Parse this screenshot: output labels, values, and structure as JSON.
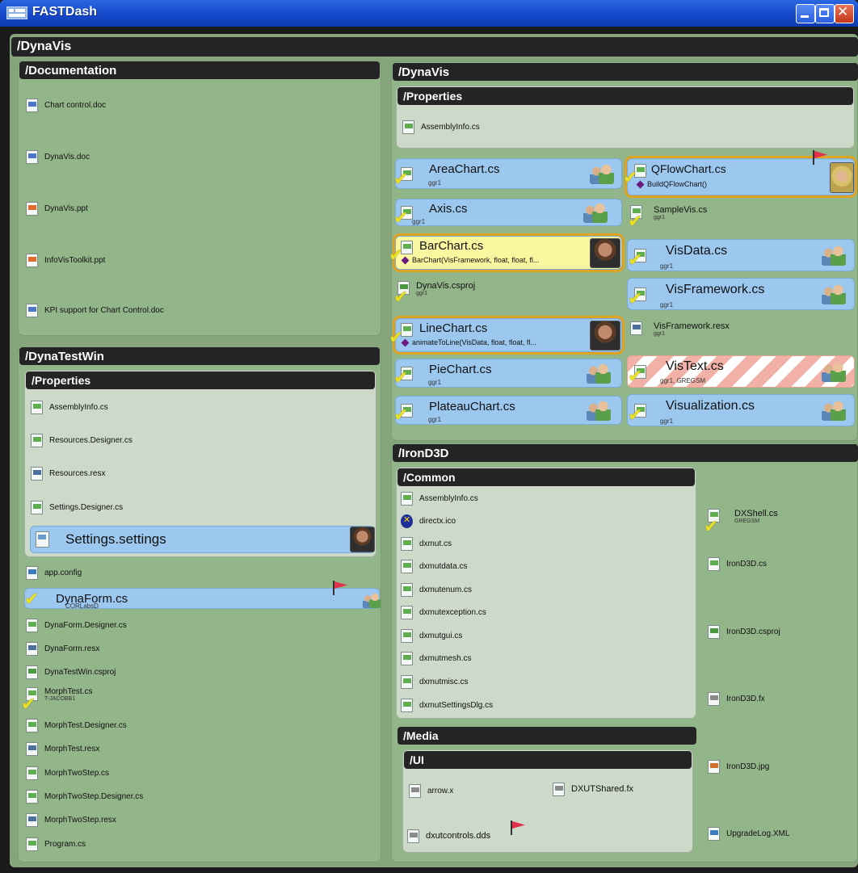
{
  "window": {
    "title": "FASTDash",
    "controls": [
      "minimize-icon",
      "maximize-icon",
      "close-icon"
    ],
    "root_header": "/DynaVis"
  },
  "documentation": {
    "header": "/Documentation",
    "files": [
      {
        "name": "Chart control.doc",
        "icon": "word-doc-icon"
      },
      {
        "name": "DynaVis.doc",
        "icon": "word-doc-icon"
      },
      {
        "name": "DynaVis.ppt",
        "icon": "powerpoint-icon"
      },
      {
        "name": "InfoVisToolkit.ppt",
        "icon": "powerpoint-icon"
      },
      {
        "name": "KPI support for Chart Control.doc",
        "icon": "word-doc-icon"
      }
    ]
  },
  "dynatestwin": {
    "header": "/DynaTestWin",
    "properties": {
      "header": "/Properties",
      "files": [
        "AssemblyInfo.cs",
        "Resources.Designer.cs",
        "Resources.resx",
        "Settings.Designer.cs"
      ],
      "active_file": "Settings.settings"
    },
    "files": [
      {
        "name": "app.config"
      },
      {
        "name": "DynaForm.cs",
        "user": "CORLabsD"
      },
      {
        "name": "DynaForm.Designer.cs"
      },
      {
        "name": "DynaForm.resx"
      },
      {
        "name": "DynaTestWin.csproj"
      },
      {
        "name": "MorphTest.cs",
        "user": "T-JACOBB1"
      },
      {
        "name": "MorphTest.Designer.cs"
      },
      {
        "name": "MorphTest.resx"
      },
      {
        "name": "MorphTwoStep.cs"
      },
      {
        "name": "MorphTwoStep.Designer.cs"
      },
      {
        "name": "MorphTwoStep.resx"
      },
      {
        "name": "Program.cs"
      }
    ]
  },
  "dynavis": {
    "header": "/DynaVis",
    "properties": {
      "header": "/Properties",
      "files": [
        "AssemblyInfo.cs"
      ]
    },
    "left_files": [
      {
        "name": "AreaChart.cs",
        "user": "ggr1"
      },
      {
        "name": "Axis.cs",
        "user": "ggr1"
      },
      {
        "name": "BarChart.cs",
        "method": "BarChart(VisFramework, float, float, fl..."
      },
      {
        "name": "DynaVis.csproj",
        "user": "ggr1"
      },
      {
        "name": "LineChart.cs",
        "method": "animateToLine(VisData, float, float, fl..."
      },
      {
        "name": "PieChart.cs",
        "user": "ggr1"
      },
      {
        "name": "PlateauChart.cs",
        "user": "ggr1"
      }
    ],
    "right_files": [
      {
        "name": "QFlowChart.cs",
        "method": "BuildQFlowChart()"
      },
      {
        "name": "SampleVis.cs",
        "user": "ggr1"
      },
      {
        "name": "VisData.cs",
        "user": "ggr1"
      },
      {
        "name": "VisFramework.cs",
        "user": "ggr1"
      },
      {
        "name": "VisFramework.resx",
        "user": "ggr1"
      },
      {
        "name": "VisText.cs",
        "user": "ggr1, GREGSM"
      },
      {
        "name": "Visualization.cs",
        "user": "ggr1"
      }
    ]
  },
  "irond3d": {
    "header": "/IronD3D",
    "common": {
      "header": "/Common",
      "files": [
        "AssemblyInfo.cs",
        "directx.ico",
        "dxmut.cs",
        "dxmutdata.cs",
        "dxmutenum.cs",
        "dxmutexception.cs",
        "dxmutgui.cs",
        "dxmutmesh.cs",
        "dxmutmisc.cs",
        "dxmutSettingsDlg.cs"
      ]
    },
    "media": {
      "header": "/Media",
      "ui": {
        "header": "/UI",
        "files": [
          "arrow.x",
          "DXUTShared.fx",
          "dxutcontrols.dds"
        ]
      }
    },
    "files": [
      {
        "name": "DXShell.cs",
        "user": "GREGSM"
      },
      {
        "name": "IronD3D.cs"
      },
      {
        "name": "IronD3D.csproj"
      },
      {
        "name": "IronD3D.fx"
      },
      {
        "name": "IronD3D.jpg"
      },
      {
        "name": "UpgradeLog.XML"
      }
    ]
  },
  "colors": {
    "title_bar": "#1447c8",
    "panel_green": "#93b58a",
    "tile_blue": "#9cc8f0",
    "tile_yellow": "#fbf7a0",
    "ring_orange": "#e1a21d",
    "header_dark": "#242424",
    "flag_red": "#e0304a"
  }
}
